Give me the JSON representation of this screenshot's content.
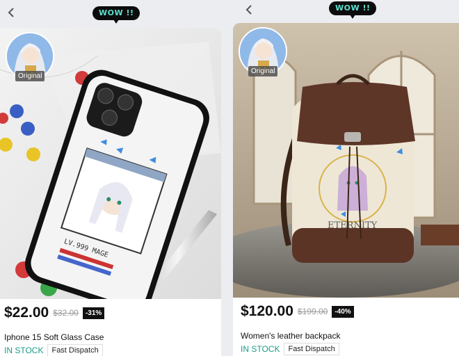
{
  "colors": {
    "accent_teal": "#1a9c8a",
    "wow_text": "#5ee0d0",
    "discount_bg": "#111111"
  },
  "products": [
    {
      "wow_badge": "WOW !!",
      "original_tag": "Original",
      "price": "$22.00",
      "original_price": "$32.00",
      "discount": "-31%",
      "title": "Iphone 15 Soft Glass Case",
      "stock": "IN STOCK",
      "dispatch": "Fast Dispatch",
      "art_text": "LV.999 MAGE"
    },
    {
      "wow_badge": "WOW !!",
      "original_tag": "Original",
      "price": "$120.00",
      "original_price": "$199.00",
      "discount": "-40%",
      "title": "Women's leather backpack",
      "stock": "IN STOCK",
      "dispatch": "Fast Dispatch",
      "art_text": "ETERNITY"
    }
  ],
  "icons": {
    "back": "chevron-left-icon"
  }
}
